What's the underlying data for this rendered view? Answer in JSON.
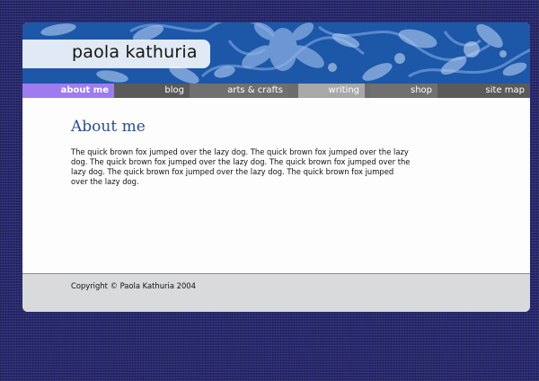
{
  "site": {
    "title": "paola kathuria"
  },
  "nav": {
    "items": [
      {
        "label": "about me"
      },
      {
        "label": "blog"
      },
      {
        "label": "arts & crafts"
      },
      {
        "label": "writing"
      },
      {
        "label": "shop"
      },
      {
        "label": "site map"
      }
    ],
    "active": "about me"
  },
  "main": {
    "heading": "About me",
    "body": "The quick brown fox jumped over the lazy dog. The quick brown fox jumped over the lazy dog. The quick brown fox jumped over the lazy dog. The quick brown fox jumped over the lazy dog. The quick brown fox jumped over the lazy dog. The quick brown fox jumped over the lazy dog."
  },
  "footer": {
    "copyright": "Copyright © Paola Kathuria 2004"
  },
  "colors": {
    "background": "#27286e",
    "banner": "#1c57a8",
    "nav_active": "#9e7cf0",
    "nav_bar": "#6c6c6c",
    "heading": "#2b4f8a",
    "footer": "#d9dadb"
  }
}
